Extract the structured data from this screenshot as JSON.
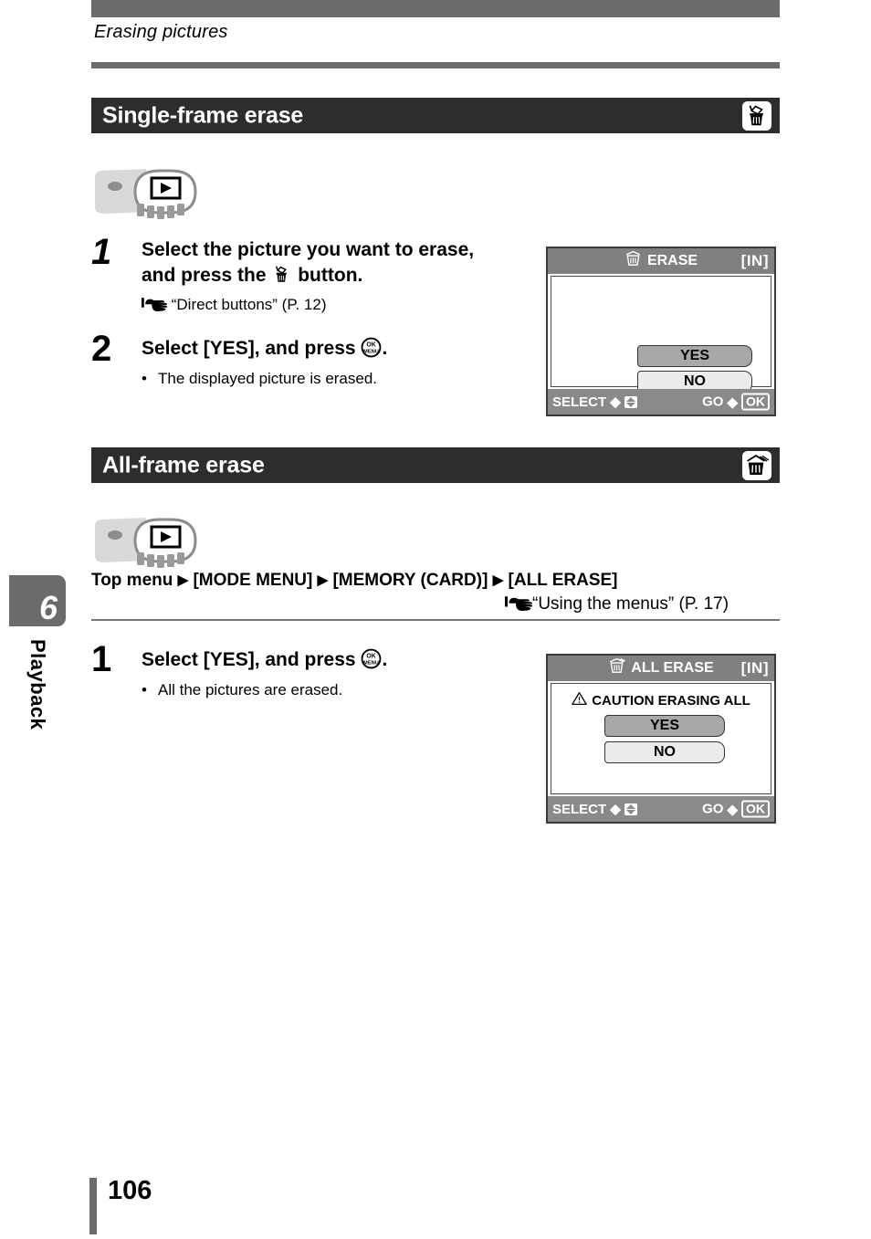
{
  "page": {
    "running_head": "Erasing pictures",
    "page_number": "106",
    "chapter_number": "6",
    "chapter_label": "Playback"
  },
  "sections": [
    {
      "title": "Single-frame erase",
      "badge_icon": "trash-single-icon",
      "camera_illustration": "playback-button-icon",
      "steps": [
        {
          "number": "1",
          "text_before": "Select the picture you want to erase, and press the",
          "inline_icon": "trash-single-icon",
          "text_after": "button.",
          "reference": "“Direct buttons” (P. 12)",
          "reference_icon": "pointing-hand-icon"
        },
        {
          "number": "2",
          "text_before": "Select [YES], and press",
          "inline_icon": "ok-menu-button-icon",
          "text_after": ".",
          "bullet": "The displayed picture is erased."
        }
      ],
      "lcd": {
        "icon": "trash-basket-icon",
        "title": "ERASE",
        "location": "[IN]",
        "caution": null,
        "options": [
          {
            "label": "YES",
            "selected": true
          },
          {
            "label": "NO",
            "selected": false
          }
        ],
        "footer_left_label": "SELECT",
        "footer_left_icon": "up-down-arrows-icon",
        "footer_right_label": "GO",
        "footer_right_icon": "OK"
      }
    },
    {
      "title": "All-frame erase",
      "badge_icon": "trash-all-icon",
      "camera_illustration": "playback-button-icon",
      "menu_path": [
        "Top menu",
        "[MODE MENU]",
        "[MEMORY (CARD)]",
        "[ALL ERASE]"
      ],
      "menu_path_separator": "▶",
      "reference": "“Using the menus” (P. 17)",
      "reference_icon": "pointing-hand-icon",
      "steps": [
        {
          "number": "1",
          "text_before": "Select [YES], and press",
          "inline_icon": "ok-menu-button-icon",
          "text_after": ".",
          "bullet": "All the pictures are erased."
        }
      ],
      "lcd": {
        "icon": "trash-basket-icon",
        "title": "ALL ERASE",
        "location": "[IN]",
        "caution": "CAUTION ERASING ALL",
        "caution_icon": "warning-triangle-icon",
        "options": [
          {
            "label": "YES",
            "selected": true
          },
          {
            "label": "NO",
            "selected": false
          }
        ],
        "footer_left_label": "SELECT",
        "footer_left_icon": "up-down-arrows-icon",
        "footer_right_label": "GO",
        "footer_right_icon": "OK"
      }
    }
  ],
  "colors": {
    "rule_gray": "#6b6b6b",
    "section_bar": "#2d2d2d",
    "lcd_title_bar": "#808080",
    "lcd_footer_bar": "#8a8a8a",
    "selected_option": "#a8a8a8",
    "unselected_option": "#ececec"
  }
}
